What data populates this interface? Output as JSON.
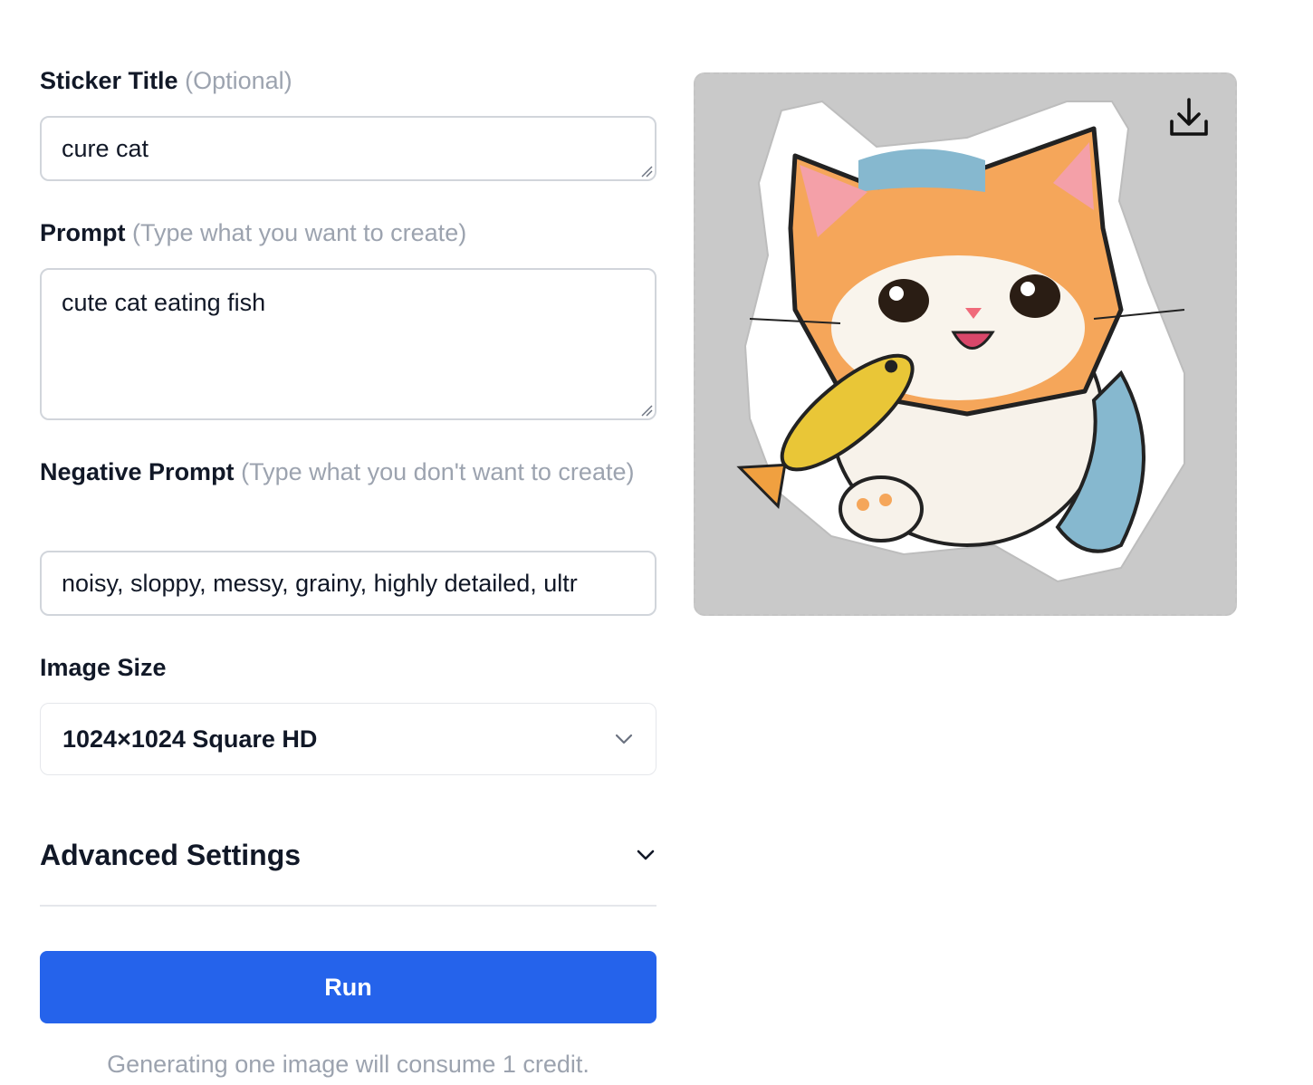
{
  "form": {
    "sticker_title": {
      "label": "Sticker Title",
      "hint": "(Optional)",
      "value": "cure cat"
    },
    "prompt": {
      "label": "Prompt",
      "hint": "(Type what you want to create)",
      "value": "cute cat eating fish"
    },
    "negative_prompt": {
      "label": "Negative Prompt",
      "hint": "(Type what you don't want to create)",
      "value": "noisy, sloppy, messy, grainy, highly detailed, ultr"
    },
    "image_size": {
      "label": "Image Size",
      "selected": "1024×1024 Square HD"
    },
    "advanced_settings": "Advanced Settings",
    "run_label": "Run",
    "credit_note": "Generating one image will consume 1 credit."
  },
  "preview": {
    "download_icon": "download-icon",
    "image_icon": "cat-sticker-image"
  },
  "colors": {
    "primary": "#2563eb",
    "muted": "#9ca3af",
    "border": "#d1d5db",
    "preview_bg": "#c9c9c9"
  }
}
